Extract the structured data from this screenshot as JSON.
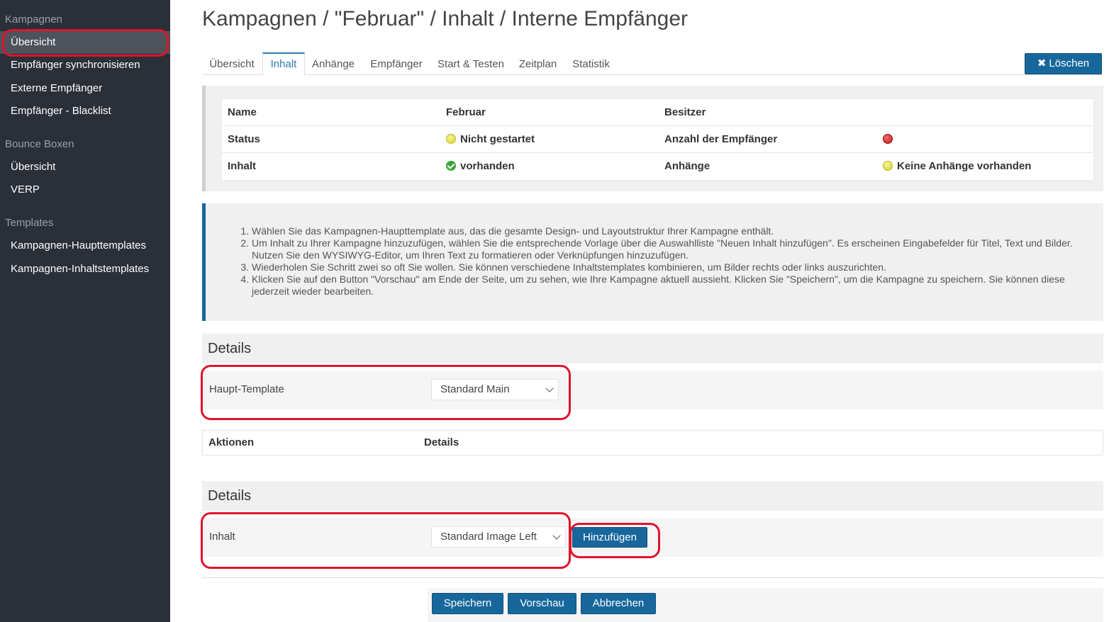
{
  "sidebar": {
    "sections": [
      {
        "title": "Kampagnen",
        "items": [
          "Übersicht",
          "Empfänger synchronisieren",
          "Externe Empfänger",
          "Empfänger - Blacklist"
        ]
      },
      {
        "title": "Bounce Boxen",
        "items": [
          "Übersicht",
          "VERP"
        ]
      },
      {
        "title": "Templates",
        "items": [
          "Kampagnen-Haupttemplates",
          "Kampagnen-Inhaltstemplates"
        ]
      }
    ]
  },
  "page": {
    "title": "Kampagnen / \"Februar\" / Inhalt / Interne Empfänger"
  },
  "tabs": [
    "Übersicht",
    "Inhalt",
    "Anhänge",
    "Empfänger",
    "Start & Testen",
    "Zeitplan",
    "Statistik"
  ],
  "active_tab": "Inhalt",
  "delete_button": {
    "icon": "x-icon",
    "label": "Löschen"
  },
  "info": {
    "name_label": "Name",
    "name_value": "Februar",
    "owner_label": "Besitzer",
    "status_label": "Status",
    "status_value": "Nicht gestartet",
    "recipients_label": "Anzahl der Empfänger",
    "content_label": "Inhalt",
    "content_value": "vorhanden",
    "attachments_label": "Anhänge",
    "attachments_value": "Keine Anhänge vorhanden"
  },
  "instructions": [
    "Wählen Sie das Kampagnen-Haupttemplate aus, das die gesamte Design- und Layoutstruktur Ihrer Kampagne enthält.",
    "Um Inhalt zu Ihrer Kampagne hinzuzufügen, wählen Sie die entsprechende Vorlage über die Auswahlliste \"Neuen Inhalt hinzufügen\". Es erscheinen Eingabefelder für Titel, Text und Bilder. Nutzen Sie den WYSIWYG-Editor, um Ihren Text zu formatieren oder Verknüpfungen hinzuzufügen.",
    "Wiederholen Sie Schritt zwei so oft Sie wollen. Sie können verschiedene Inhaltstemplates kombinieren, um Bilder rechts oder links auszurichten.",
    "Klicken Sie auf den Button \"Vorschau\" am Ende der Seite, um zu sehen, wie Ihre Kampagne aktuell aussieht. Klicken Sie \"Speichern\", um die Kampagne zu speichern. Sie können diese jederzeit wieder bearbeiten."
  ],
  "details1": {
    "title": "Details",
    "label": "Haupt-Template",
    "selected": "Standard Main"
  },
  "actions_table": {
    "col1": "Aktionen",
    "col2": "Details"
  },
  "details2": {
    "title": "Details",
    "label": "Inhalt",
    "selected": "Standard Image Left",
    "add_button": "Hinzufügen"
  },
  "footer": {
    "save": "Speichern",
    "preview": "Vorschau",
    "cancel": "Abbrechen"
  },
  "colors": {
    "primary": "#17679c",
    "sidebar": "#2a2f38",
    "annotation": "#e0142b"
  }
}
